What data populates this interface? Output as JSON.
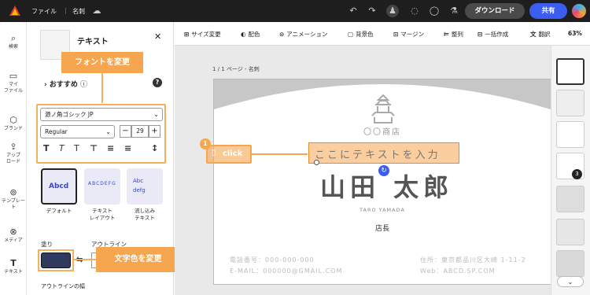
{
  "app": {
    "menu_file": "ファイル",
    "doc_name": "名刺",
    "download": "ダウンロード",
    "share": "共有"
  },
  "rail": [
    {
      "label": "検索",
      "icon": "search-icon"
    },
    {
      "label": "マイ\nファイル",
      "icon": "folder-icon"
    },
    {
      "label": "ブランド",
      "icon": "brand-icon"
    },
    {
      "label": "アップ\nロード",
      "icon": "upload-icon"
    },
    {
      "label": "テンプレー\nト",
      "icon": "template-icon"
    },
    {
      "label": "メディア",
      "icon": "media-icon"
    },
    {
      "label": "テキスト",
      "icon": "text-icon"
    }
  ],
  "panel": {
    "title": "テキスト",
    "recommended": "おすすめ",
    "font": "源ノ角ゴシック JP",
    "weight": "Regular",
    "size": "29",
    "fill_label": "塗り",
    "outline_label": "アウトライン",
    "outline_width_label": "アウトラインの幅",
    "styles": [
      {
        "label": "デフォルト",
        "sample": "Abcd"
      },
      {
        "label": "テキスト\nレイアウト",
        "sample": "ABCDEFG"
      },
      {
        "label": "流し込み\nテキスト",
        "sample": "Abc defg"
      }
    ]
  },
  "callouts": {
    "font": "フォントを変更",
    "color": "文字色を変更"
  },
  "toolbar": [
    {
      "label": "サイズ変更",
      "icon": "resize-icon"
    },
    {
      "label": "配色",
      "icon": "palette-icon"
    },
    {
      "label": "アニメーション",
      "icon": "animation-icon"
    },
    {
      "label": "背景色",
      "icon": "bgcolor-icon"
    },
    {
      "label": "マージン",
      "icon": "margin-icon"
    },
    {
      "label": "整列",
      "icon": "align-icon"
    },
    {
      "label": "一括作成",
      "icon": "bulk-icon"
    },
    {
      "label": "翻訳",
      "icon": "translate-icon"
    }
  ],
  "zoom": "63%",
  "stage": {
    "page_label": "1 / 1 ページ - 名刺"
  },
  "card": {
    "shop": "〇〇商店",
    "placeholder": "ここにテキストを入力",
    "name": "山田 太郎",
    "romaji": "TARO YAMADA",
    "title": "店長",
    "phone": "電話番号：000-000-000",
    "email": "E-MAIL：000000@GMAIL.COM",
    "address": "住所：東京都品川区大崎 1-11-2",
    "web": "Web：ABCD.SP.COM"
  },
  "step": {
    "number": "1",
    "click": "click"
  },
  "pages_badge": "3",
  "colors": {
    "accent": "#f5a64e",
    "share": "#3b5ef0",
    "fill": "#2f3a5e"
  }
}
